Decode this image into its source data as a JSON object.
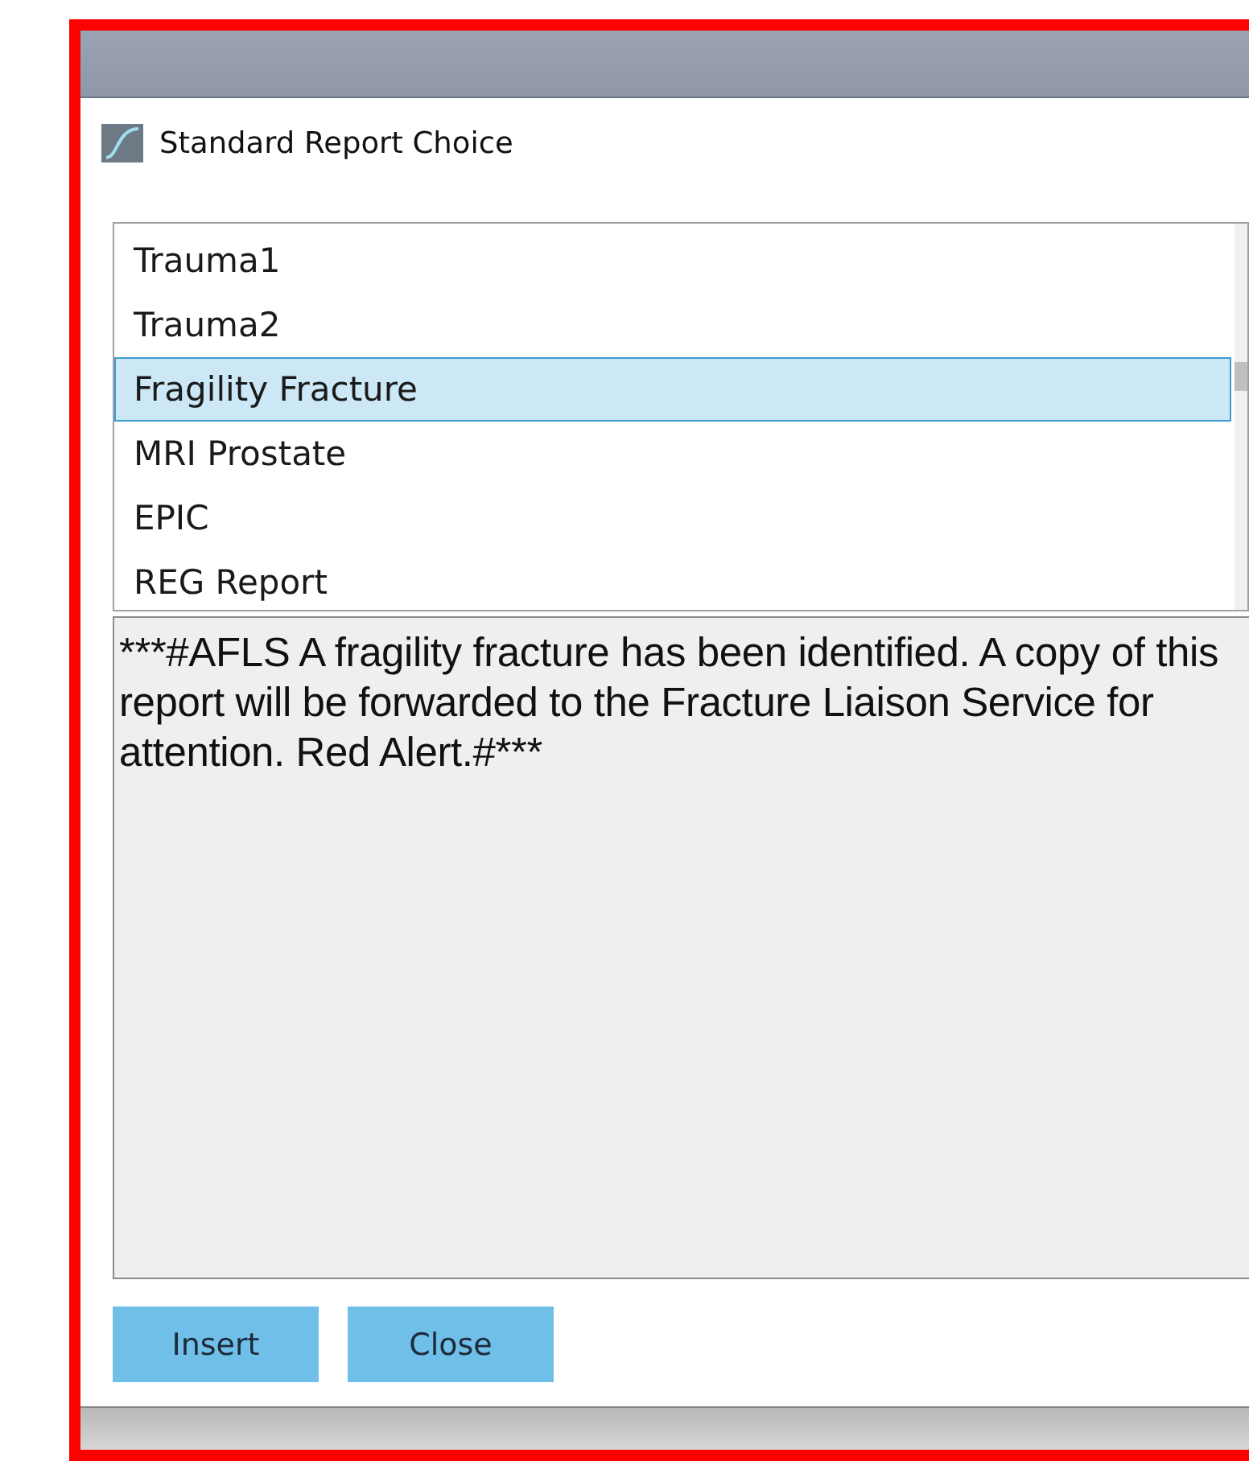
{
  "dialog": {
    "title": "Standard Report Choice"
  },
  "reports": [
    {
      "label": "Trauma1",
      "selected": false
    },
    {
      "label": "Trauma2",
      "selected": false
    },
    {
      "label": "Fragility Fracture",
      "selected": true
    },
    {
      "label": "MRI Prostate",
      "selected": false
    },
    {
      "label": "EPIC",
      "selected": false
    },
    {
      "label": "REG Report",
      "selected": false
    }
  ],
  "report_text": [
    "***#AFLS A fragility fracture has been identified. A copy of this",
    "report will be forwarded to the Fracture Liaison Service for",
    "attention. Red Alert.#***"
  ],
  "buttons": [
    "Insert",
    "Close"
  ]
}
